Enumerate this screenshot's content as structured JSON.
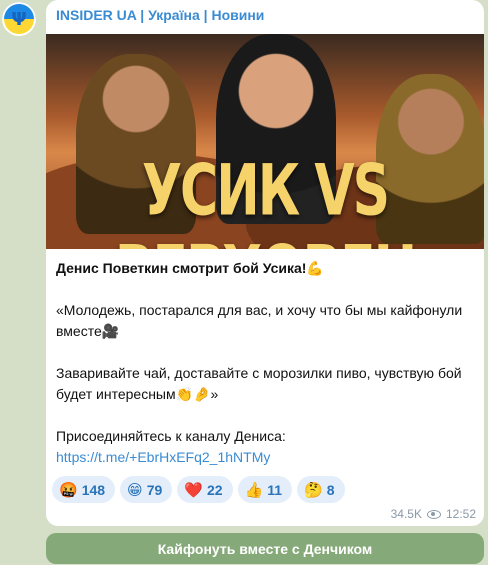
{
  "channel": {
    "avatar_glyph": "Ψ",
    "title": "INSIDER UA | Україна | Новини"
  },
  "post": {
    "image_headline": "УСИК VS ВЕРХОВЕН",
    "lines": {
      "l1": "Денис Поветкин смотрит бой Усика!💪",
      "l2": "«Молодежь, постарался для вас, и хочу что бы мы кайфонули вместе🎥",
      "l3": "Заваривайте чай, доставайте с морозилки пиво, чувствую бой будет интересным👏🤌»",
      "l4": "Присоединяйтесь к каналу Дениса:",
      "link": "https://t.me/+EbrHxEFq2_1hNTMy"
    },
    "reactions": [
      {
        "emoji": "🤬",
        "count": "148"
      },
      {
        "emoji": "😁",
        "count": "79"
      },
      {
        "emoji": "❤️",
        "count": "22"
      },
      {
        "emoji": "👍",
        "count": "11"
      },
      {
        "emoji": "🤔",
        "count": "8"
      }
    ],
    "views": "34.5K",
    "time": "12:52"
  },
  "button": {
    "label": "Кайфонуть вместе с Денчиком"
  },
  "colors": {
    "background": "#d5dfc8",
    "accent": "#3a8bd2",
    "button": "#86a97a"
  }
}
